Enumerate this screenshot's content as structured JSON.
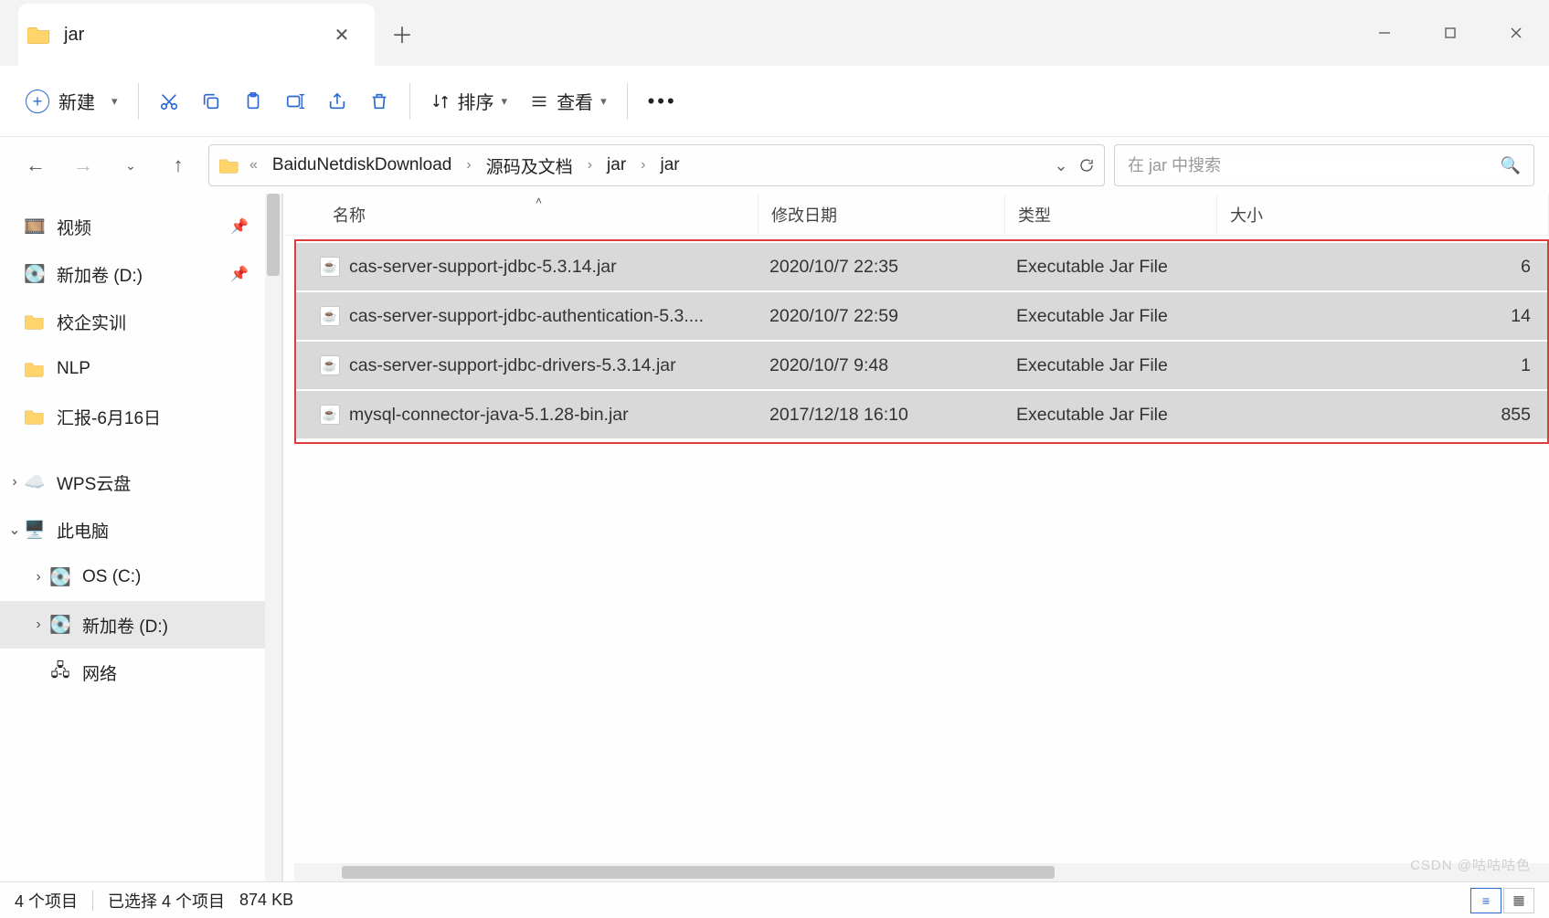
{
  "tab": {
    "title": "jar"
  },
  "toolbar": {
    "new_label": "新建",
    "sort_label": "排序",
    "view_label": "查看"
  },
  "breadcrumb": {
    "items": [
      "BaiduNetdiskDownload",
      "源码及文档",
      "jar",
      "jar"
    ]
  },
  "search": {
    "placeholder": "在 jar 中搜索"
  },
  "sidebar": {
    "quick": [
      {
        "label": "视频",
        "pinned": true,
        "icon": "video"
      },
      {
        "label": "新加卷 (D:)",
        "pinned": true,
        "icon": "drive"
      },
      {
        "label": "校企实训",
        "icon": "folder"
      },
      {
        "label": "NLP",
        "icon": "folder"
      },
      {
        "label": "汇报-6月16日",
        "icon": "folder"
      }
    ],
    "groups": [
      {
        "label": "WPS云盘",
        "icon": "cloud",
        "expandable": true,
        "expanded": false
      },
      {
        "label": "此电脑",
        "icon": "pc",
        "expandable": true,
        "expanded": true,
        "children": [
          {
            "label": "OS (C:)",
            "icon": "drive-os",
            "expandable": true
          },
          {
            "label": "新加卷 (D:)",
            "icon": "drive",
            "expandable": true,
            "selected": true
          }
        ]
      },
      {
        "label": "网络",
        "icon": "network"
      }
    ]
  },
  "columns": {
    "name": "名称",
    "date": "修改日期",
    "type": "类型",
    "size": "大小"
  },
  "files": [
    {
      "name": "cas-server-support-jdbc-5.3.14.jar",
      "date": "2020/10/7 22:35",
      "type": "Executable Jar File",
      "size": "6"
    },
    {
      "name": "cas-server-support-jdbc-authentication-5.3....",
      "date": "2020/10/7 22:59",
      "type": "Executable Jar File",
      "size": "14"
    },
    {
      "name": "cas-server-support-jdbc-drivers-5.3.14.jar",
      "date": "2020/10/7 9:48",
      "type": "Executable Jar File",
      "size": "1"
    },
    {
      "name": "mysql-connector-java-5.1.28-bin.jar",
      "date": "2017/12/18 16:10",
      "type": "Executable Jar File",
      "size": "855"
    }
  ],
  "status": {
    "count": "4 个项目",
    "selected": "已选择 4 个项目",
    "size": "874 KB"
  },
  "watermark": "CSDN @咕咕咕色"
}
